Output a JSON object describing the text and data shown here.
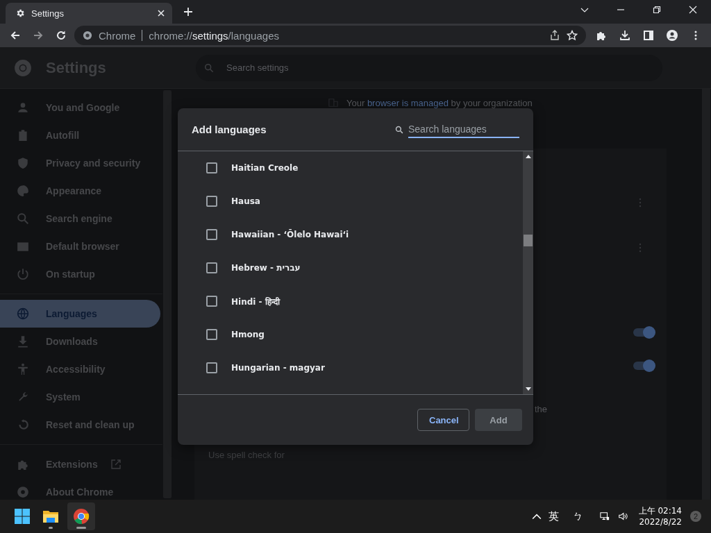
{
  "browser": {
    "tab": {
      "title": "Settings"
    },
    "address": {
      "site": "Chrome",
      "url_scheme": "chrome://",
      "url_host": "settings",
      "url_path": "/languages"
    }
  },
  "header": {
    "title": "Settings",
    "search": {
      "placeholder": "Search settings"
    }
  },
  "sidebar": {
    "groups": [
      {
        "items": [
          {
            "label": "You and Google",
            "selected": false,
            "kind": "page"
          },
          {
            "label": "Autofill",
            "selected": false,
            "kind": "page"
          },
          {
            "label": "Privacy and security",
            "selected": false,
            "kind": "page"
          },
          {
            "label": "Appearance",
            "selected": false,
            "kind": "page"
          },
          {
            "label": "Search engine",
            "selected": false,
            "kind": "page"
          },
          {
            "label": "Default browser",
            "selected": false,
            "kind": "page"
          },
          {
            "label": "On startup",
            "selected": false,
            "kind": "page"
          }
        ]
      },
      {
        "items": [
          {
            "label": "Languages",
            "selected": true,
            "kind": "page"
          },
          {
            "label": "Downloads",
            "selected": false,
            "kind": "page"
          },
          {
            "label": "Accessibility",
            "selected": false,
            "kind": "page"
          },
          {
            "label": "System",
            "selected": false,
            "kind": "page"
          },
          {
            "label": "Reset and clean up",
            "selected": false,
            "kind": "page"
          }
        ]
      },
      {
        "items": [
          {
            "label": "Extensions",
            "selected": false,
            "kind": "external"
          },
          {
            "label": "About Chrome",
            "selected": false,
            "kind": "page"
          }
        ]
      }
    ]
  },
  "main": {
    "managed_notice": {
      "before": "Your",
      "link": "browser is managed",
      "after": "by your organization"
    },
    "toggles": [
      {
        "on": true
      },
      {
        "on": true
      }
    ],
    "partial_text": "the",
    "spell_check_label": "Use spell check for"
  },
  "dialog": {
    "title": "Add languages",
    "search": {
      "placeholder": "Search languages"
    },
    "languages": [
      {
        "label": "Haitian Creole",
        "checked": false
      },
      {
        "label": "Hausa",
        "checked": false
      },
      {
        "label": "Hawaiian - ʻŌlelo Hawaiʻi",
        "checked": false
      },
      {
        "label": "Hebrew - עברית",
        "checked": false
      },
      {
        "label": "Hindi - हिन्दी",
        "checked": false
      },
      {
        "label": "Hmong",
        "checked": false
      },
      {
        "label": "Hungarian - magyar",
        "checked": false
      }
    ],
    "buttons": [
      {
        "label": "Cancel",
        "kind": "cancel",
        "disabled": false
      },
      {
        "label": "Add",
        "kind": "action",
        "disabled": true
      }
    ]
  },
  "taskbar": {
    "input_mode": "英",
    "ime": "ㄅ",
    "time": "上午 02:14",
    "date": "2022/8/22",
    "notification_count": "2"
  }
}
